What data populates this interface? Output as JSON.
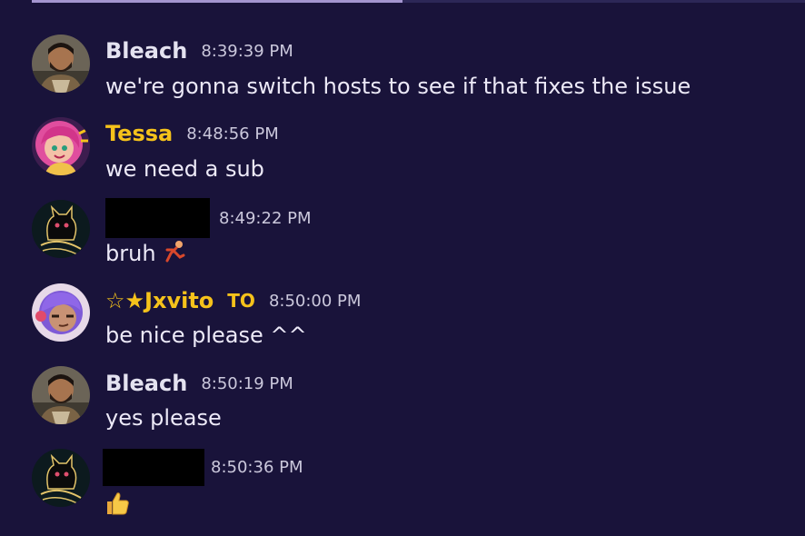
{
  "progress": {
    "fraction": 0.48
  },
  "messages": [
    {
      "author": "Bleach",
      "time": "8:39:39 PM",
      "text": "we're gonna switch hosts to see if that fixes the issue",
      "avatar_icon": "bearded-man-avatar-icon"
    },
    {
      "author": "Tessa",
      "time": "8:48:56 PM",
      "text": "we need a sub",
      "author_color": "#f5c21b",
      "avatar_icon": "pink-hair-girl-avatar-icon"
    },
    {
      "author": "",
      "time": "8:49:22 PM",
      "text": "bruh",
      "avatar_icon": "dark-cat-astronaut-avatar-icon",
      "emoji_icon": "person-falling-emoji-icon"
    },
    {
      "author": "☆★Jxvito",
      "badge": "TO",
      "time": "8:50:00 PM",
      "text": "be nice please ^^",
      "author_color": "#f5c21b",
      "avatar_icon": "purple-hair-character-avatar-icon"
    },
    {
      "author": "Bleach",
      "time": "8:50:19 PM",
      "text": "yes please",
      "avatar_icon": "bearded-man-avatar-icon"
    },
    {
      "author": "",
      "time": "8:50:36 PM",
      "text": "",
      "avatar_icon": "dark-cat-astronaut-avatar-icon",
      "emoji_icon": "thumbs-up-emoji-icon"
    }
  ],
  "colors": {
    "background": "#19133a",
    "text": "#ece9f7",
    "timestamp": "#cbc8dc",
    "highlight_name": "#f5c21b"
  }
}
